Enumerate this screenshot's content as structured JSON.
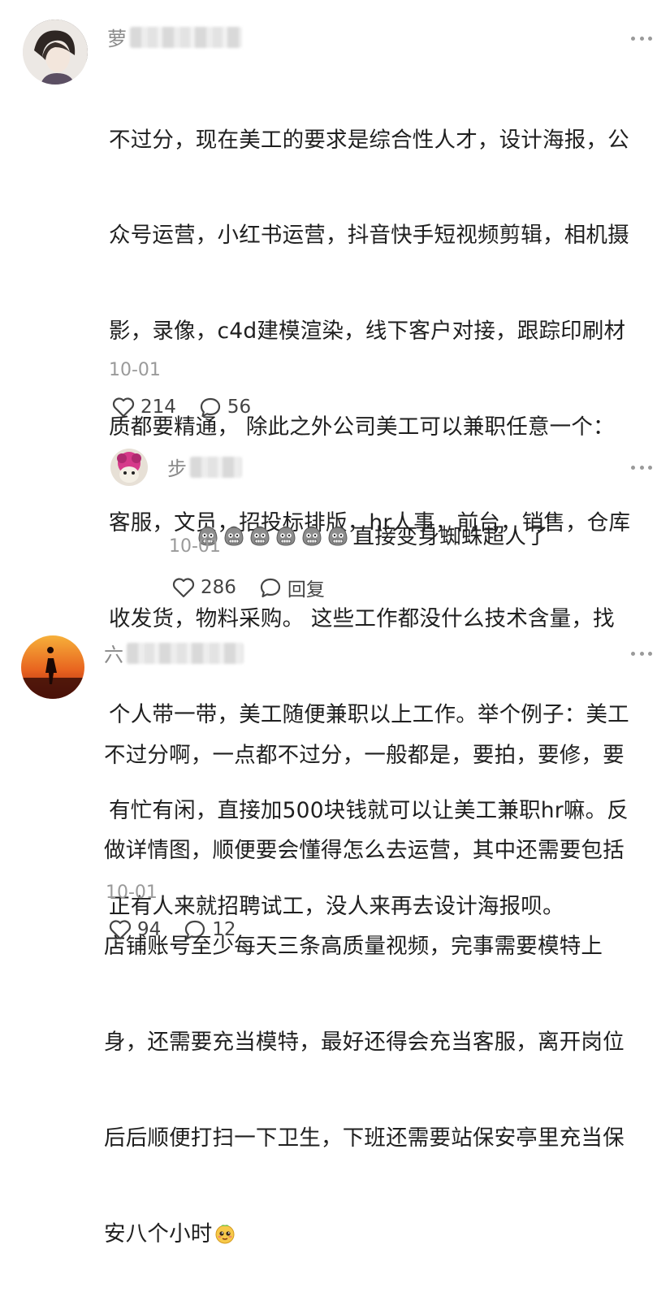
{
  "comments": [
    {
      "name_initial": "萝",
      "text_lines": [
        "不过分，现在美工的要求是综合性人才，设计海报，公",
        "众号运营，小红书运营，抖音快手短视频剪辑，相机摄",
        "影，录像，c4d建模渲染，线下客户对接，跟踪印刷材",
        "质都要精通， 除此之外公司美工可以兼职任意一个：",
        "客服，文员，招投标排版，hr人事，前台，销售，仓库",
        "收发货，物料采购。 这些工作都没什么技术含量，找",
        "个人带一带，美工随便兼职以上工作。举个例子：美工",
        "有忙有闲，直接加500块钱就可以让美工兼职hr嘛。反",
        "正有人来就招聘试工，没人来再去设计海报呗。"
      ],
      "date": "10-01",
      "likes": "214",
      "comments_count": "56"
    },
    {
      "name_initial": "步",
      "emoji_count": 6,
      "text": "直接变身蜘蛛超人了",
      "date": "10-01",
      "likes": "286",
      "reply_label": "回复"
    },
    {
      "name_initial": "六",
      "text_lines": [
        "不过分啊，一点都不过分，一般都是，要拍，要修，要",
        "做详情图，顺便要会懂得怎么去运营，其中还需要包括",
        "店铺账号至少每天三条高质量视频，完事需要模特上",
        "身，还需要充当模特，最好还得会充当客服，离开岗位",
        "后后顺便打扫一下卫生，下班还需要站保安亭里充当保",
        "安八个小时"
      ],
      "date": "10-01",
      "likes": "94",
      "comments_count": "12"
    }
  ]
}
